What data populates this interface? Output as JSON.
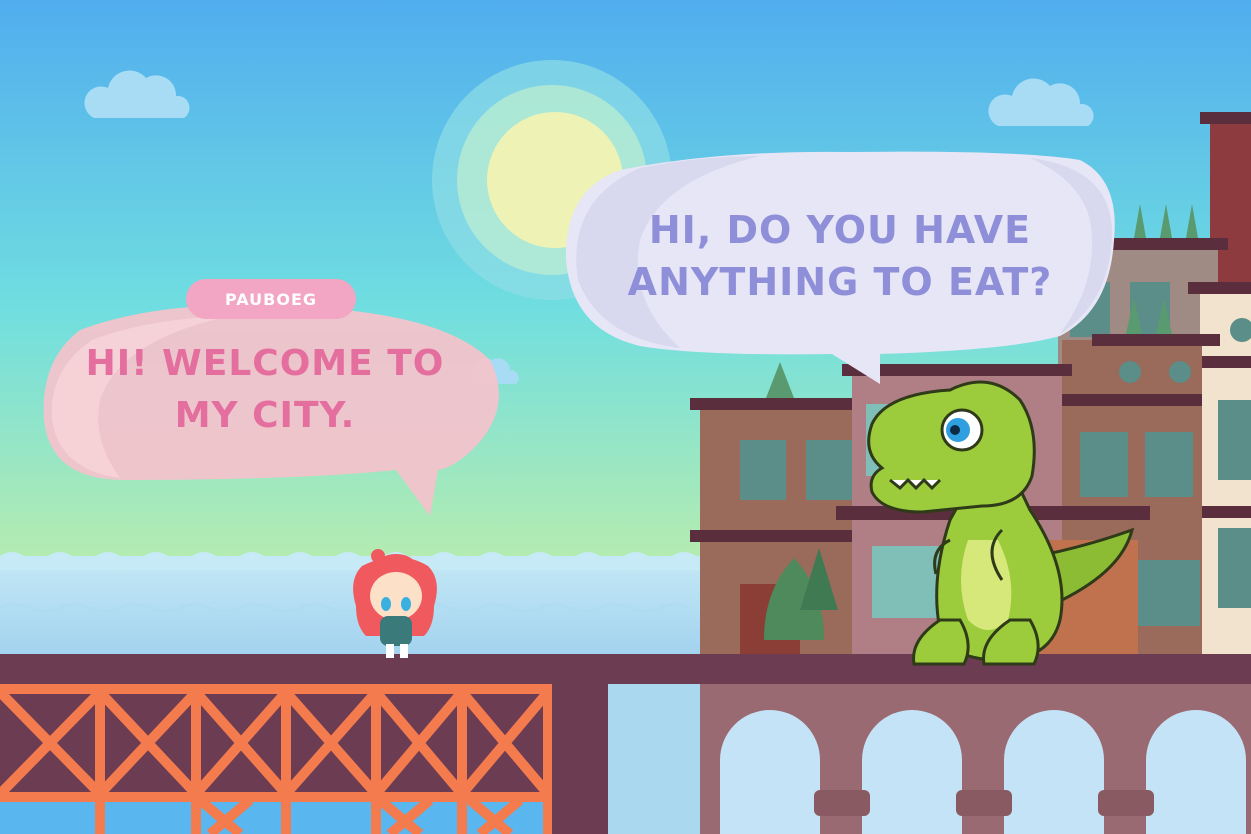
{
  "colors": {
    "sky_top": "#51adee",
    "sky_bottom": "#b5ecb0",
    "sea": "#a9d8ef",
    "bridge_orange": "#f47b4d",
    "bridge_deck": "#6b3c52",
    "aqueduct": "#9a6a72",
    "girl_bubble": "#f2c3cb",
    "girl_text": "#e46e9d",
    "dino_bubble": "#e6e6f6",
    "dino_text": "#8f8ed9",
    "name_tag": "#f2a6c4",
    "name_tag_text": "#ffffff",
    "dino_green": "#9ccc3c"
  },
  "characters": {
    "girl": {
      "name": "PAUBOEG",
      "speech": "HI! WELCOME TO MY CITY."
    },
    "dinosaur": {
      "speech": "HI, DO YOU HAVE ANYTHING TO EAT?"
    }
  },
  "icons": [
    "sun-icon",
    "cloud-icon",
    "girl-character",
    "dinosaur-character",
    "tree-icon"
  ]
}
